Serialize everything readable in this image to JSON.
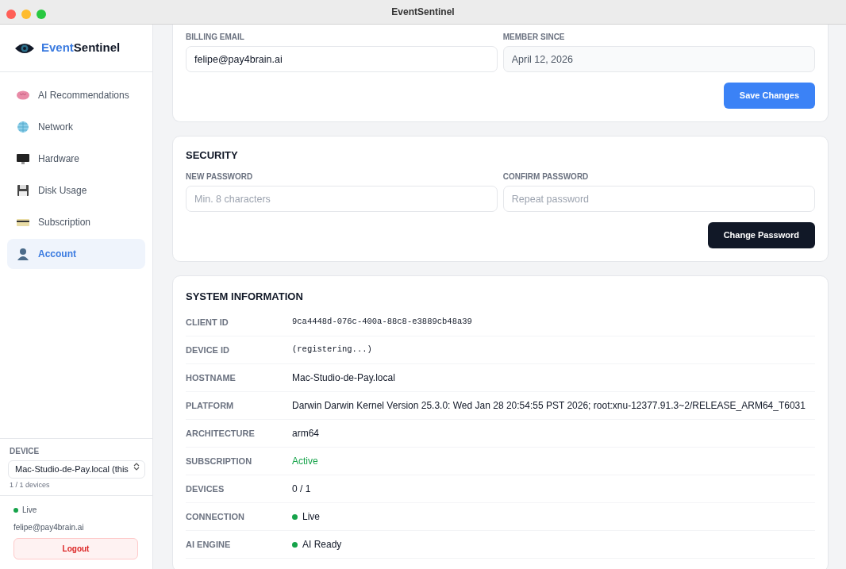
{
  "window": {
    "title": "EventSentinel"
  },
  "brand": {
    "part_1": "Event",
    "part_2": "Sentinel"
  },
  "sidebar": {
    "items": [
      {
        "label": "AI Recommendations",
        "kind": "brain",
        "selected": false
      },
      {
        "label": "Network",
        "kind": "globe",
        "selected": false
      },
      {
        "label": "Hardware",
        "kind": "monitor",
        "selected": false
      },
      {
        "label": "Disk Usage",
        "kind": "floppy",
        "selected": false
      },
      {
        "label": "Subscription",
        "kind": "card",
        "selected": false
      },
      {
        "label": "Account",
        "kind": "person",
        "selected": true
      }
    ],
    "device": {
      "label": "DEVICE",
      "value": "Mac-Studio-de-Pay.local (this",
      "count": "1 / 1 devices"
    },
    "status": "Live",
    "email": "felipe@pay4brain.ai",
    "logout": "Logout"
  },
  "billing": {
    "fields": [
      {
        "label": "BILLING EMAIL",
        "value": "felipe@pay4brain.ai",
        "disabled": false
      },
      {
        "label": "MEMBER SINCE",
        "value": "April 12, 2026",
        "disabled": true
      }
    ],
    "button": "Save Changes"
  },
  "security": {
    "title": "SECURITY",
    "fields": [
      {
        "label": "NEW PASSWORD",
        "placeholder": "Min. 8 characters"
      },
      {
        "label": "CONFIRM PASSWORD",
        "placeholder": "Repeat password"
      }
    ],
    "button": "Change Password"
  },
  "system": {
    "title": "SYSTEM INFORMATION",
    "rows": [
      {
        "label": "CLIENT ID",
        "value": "9ca4448d-076c-400a-88c8-e3889cb48a39",
        "kind": "mono"
      },
      {
        "label": "DEVICE ID",
        "value": "(registering...)",
        "kind": "mono"
      },
      {
        "label": "HOSTNAME",
        "value": "Mac-Studio-de-Pay.local",
        "kind": "text"
      },
      {
        "label": "PLATFORM",
        "value": "Darwin Darwin Kernel Version 25.3.0: Wed Jan 28 20:54:55 PST 2026; root:xnu-12377.91.3~2/RELEASE_ARM64_T6031",
        "kind": "text"
      },
      {
        "label": "ARCHITECTURE",
        "value": "arm64",
        "kind": "text"
      },
      {
        "label": "SUBSCRIPTION",
        "value": "Active",
        "kind": "status"
      },
      {
        "label": "DEVICES",
        "value": "0 / 1",
        "kind": "text"
      },
      {
        "label": "CONNECTION",
        "value": "Live",
        "kind": "dot"
      },
      {
        "label": "AI ENGINE",
        "value": "AI Ready",
        "kind": "dot"
      }
    ]
  }
}
